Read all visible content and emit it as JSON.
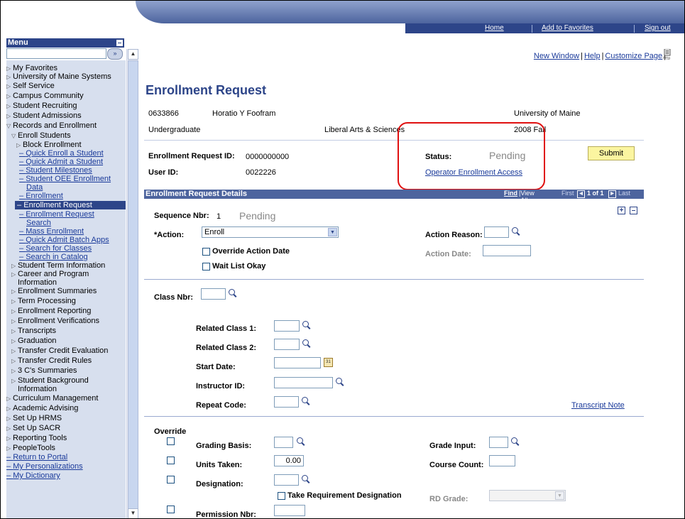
{
  "banner": {
    "home": "Home",
    "add_favorites": "Add to Favorites",
    "sign_out": "Sign out"
  },
  "toplinks": {
    "new_window": "New Window",
    "help": "Help",
    "customize": "Customize Page",
    "http_icon": "http-icon"
  },
  "menu": {
    "title": "Menu",
    "search_go": "»",
    "items": [
      "My Favorites",
      "University of Maine Systems",
      "Self Service",
      "Campus Community",
      "Student Recruiting",
      "Student Admissions",
      "Records and Enrollment",
      "Enroll Students",
      "Block Enrollment",
      "Quick Enroll a Student",
      "Quick Admit a Student",
      "Student Milestones",
      "Student OEE Enrollment",
      "Data",
      "Enrollment",
      "Enrollment Request",
      "Enrollment Request",
      "Search",
      "Mass Enrollment",
      "Quick Admit Batch Apps",
      "Search for Classes",
      "Search in Catalog",
      "Student Term Information",
      "Career and Program",
      "Information",
      "Enrollment Summaries",
      "Term Processing",
      "Enrollment Reporting",
      "Enrollment Verifications",
      "Transcripts",
      "Graduation",
      "Transfer Credit Evaluation",
      "Transfer Credit Rules",
      "3 C's Summaries",
      "Student Background",
      "Information",
      "Curriculum Management",
      "Academic Advising",
      "Set Up HRMS",
      "Set Up SACR",
      "Reporting Tools",
      "PeopleTools",
      "Return to Portal",
      "My Personalizations",
      "My Dictionary"
    ]
  },
  "page": {
    "title": "Enrollment Request",
    "student_id": "0633866",
    "student_name": "Horatio Y Foofram",
    "institution": "University of Maine",
    "career": "Undergraduate",
    "program": "Liberal Arts & Sciences",
    "term": "2008 Fall",
    "enroll_req_id_label": "Enrollment Request ID:",
    "enroll_req_id": "0000000000",
    "user_id_label": "User ID:",
    "user_id": "0022226",
    "status_label": "Status:",
    "status": "Pending",
    "operator_access": "Operator Enrollment Access",
    "submit": "Submit"
  },
  "details": {
    "header": "Enrollment Request Details",
    "find": "Find",
    "view_all": "View All",
    "first": "First",
    "range": "1 of 1",
    "last": "Last",
    "seq_label": "Sequence Nbr:",
    "seq": "1",
    "seq_status": "Pending",
    "action_label": "*Action:",
    "action_value": "Enroll",
    "action_reason_label": "Action Reason:",
    "override_action_date": "Override Action Date",
    "action_date_label": "Action Date:",
    "wait_list": "Wait List Okay",
    "class_nbr_label": "Class Nbr:",
    "related1_label": "Related Class 1:",
    "related2_label": "Related Class 2:",
    "start_date_label": "Start Date:",
    "instructor_label": "Instructor ID:",
    "repeat_label": "Repeat Code:",
    "transcript_note": "Transcript Note",
    "override_label": "Override",
    "grading_basis_label": "Grading Basis:",
    "grade_input_label": "Grade Input:",
    "units_taken_label": "Units Taken:",
    "units_taken": "0.00",
    "course_count_label": "Course Count:",
    "designation_label": "Designation:",
    "take_req_designation": "Take Requirement Designation",
    "rd_grade_label": "RD Grade:",
    "permission_label": "Permission Nbr:"
  }
}
